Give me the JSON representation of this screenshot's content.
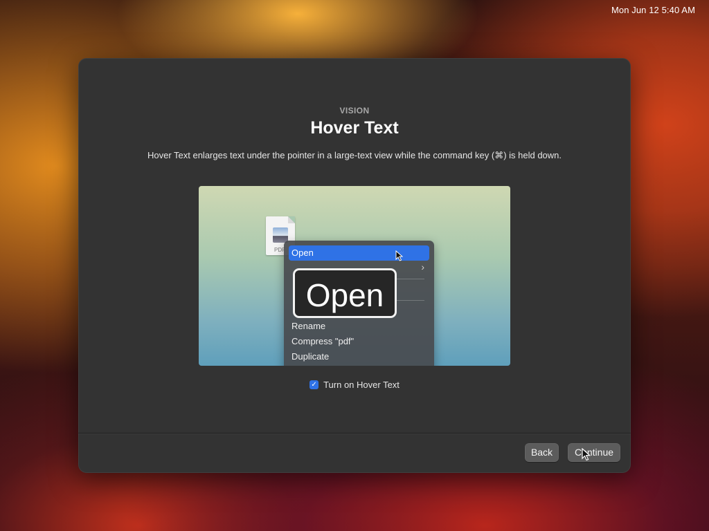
{
  "menubar": {
    "clock": "Mon Jun 12  5:40 AM"
  },
  "dialog": {
    "eyebrow": "VISION",
    "title": "Hover Text",
    "description": "Hover Text enlarges text under the pointer in a large-text view while the command key (⌘) is held down."
  },
  "preview": {
    "file_ext": "PDF",
    "menu_items": [
      "Open",
      "Rename",
      "Compress \"pdf\"",
      "Duplicate"
    ],
    "selected_item": "Open",
    "hover_text": "Open"
  },
  "checkbox": {
    "label": "Turn on Hover Text",
    "checked": true,
    "check_glyph": "✓"
  },
  "buttons": {
    "back": "Back",
    "continue": "Continue"
  },
  "colors": {
    "accent": "#2f72e6",
    "window_bg": "#333333",
    "button_bg": "#5c5c5c"
  },
  "icons": [
    "pdf-file-icon",
    "chevron-right-icon",
    "pointer-cursor-icon",
    "checkmark-icon"
  ]
}
